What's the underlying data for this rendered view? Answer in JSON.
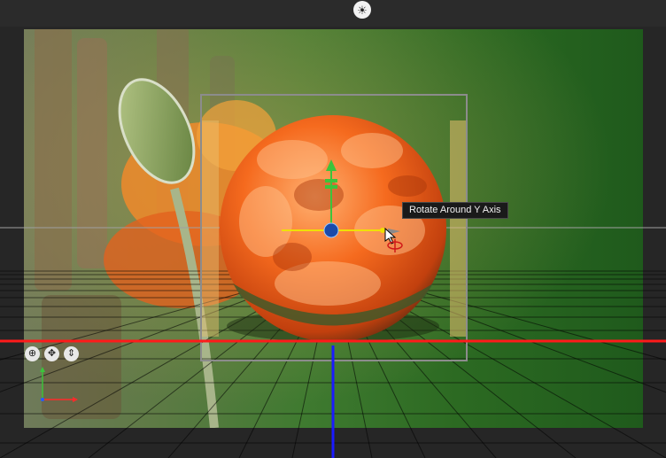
{
  "toolbar": {
    "light_icon": "sun-icon"
  },
  "tooltip": {
    "text": "Rotate Around Y Axis"
  },
  "view_controls": [
    {
      "name": "orbit-view-icon",
      "glyph": "⊕"
    },
    {
      "name": "pan-view-icon",
      "glyph": "✥"
    },
    {
      "name": "zoom-view-icon",
      "glyph": "⇕"
    }
  ],
  "colors": {
    "x_axis": "#ff1a1a",
    "y_axis": "#3cc43c",
    "z_axis": "#1a1aff",
    "gizmo_handle": "#f0e000",
    "selection_box": "#8c8c8c",
    "background": "#2b2b2b"
  }
}
